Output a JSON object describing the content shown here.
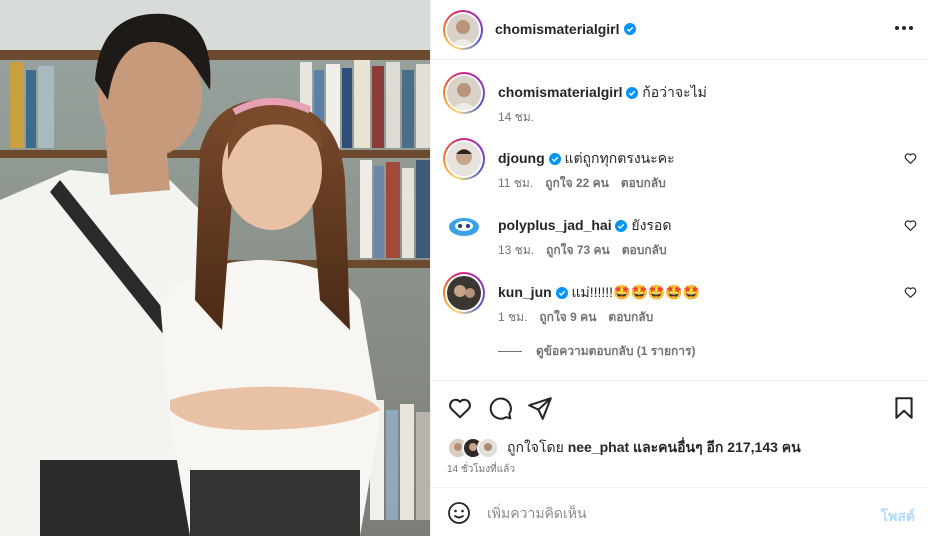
{
  "post": {
    "author": "chomismaterialgirl",
    "photo_alt": "Couple in school uniforms standing in a library",
    "more_icon": "more-options-icon"
  },
  "caption": {
    "username": "chomismaterialgirl",
    "text": "ก้อว่าจะไม่",
    "time": "14 ชม."
  },
  "comments": [
    {
      "username": "djoung",
      "text": "แต่ถูกทุกตรงนะคะ",
      "time": "11 ชม.",
      "likes": "ถูกใจ 22 คน",
      "reply": "ตอบกลับ"
    },
    {
      "username": "polyplus_jad_hai",
      "text": "ยังรอด",
      "time": "13 ชม.",
      "likes": "ถูกใจ 73 คน",
      "reply": "ตอบกลับ"
    },
    {
      "username": "kun_jun",
      "text": "แม่!!!!!!🤩🤩🤩🤩🤩",
      "time": "1 ชม.",
      "likes": "ถูกใจ 9 คน",
      "reply": "ตอบกลับ"
    }
  ],
  "view_replies": "ดูข้อความตอบกลับ (1 รายการ)",
  "likes": {
    "prefix": "ถูกใจโดย ",
    "user": "nee_phat",
    "suffix": " และคนอื่นๆ อีก 217,143 คน"
  },
  "post_time": "14 ชั่วโมงที่แล้ว",
  "composer": {
    "placeholder": "เพิ่มความคิดเห็น",
    "post_label": "โพสต์"
  },
  "colors": {
    "verified": "#0095f6",
    "post_disabled": "#b3dbff",
    "secondary_text": "#737373"
  }
}
